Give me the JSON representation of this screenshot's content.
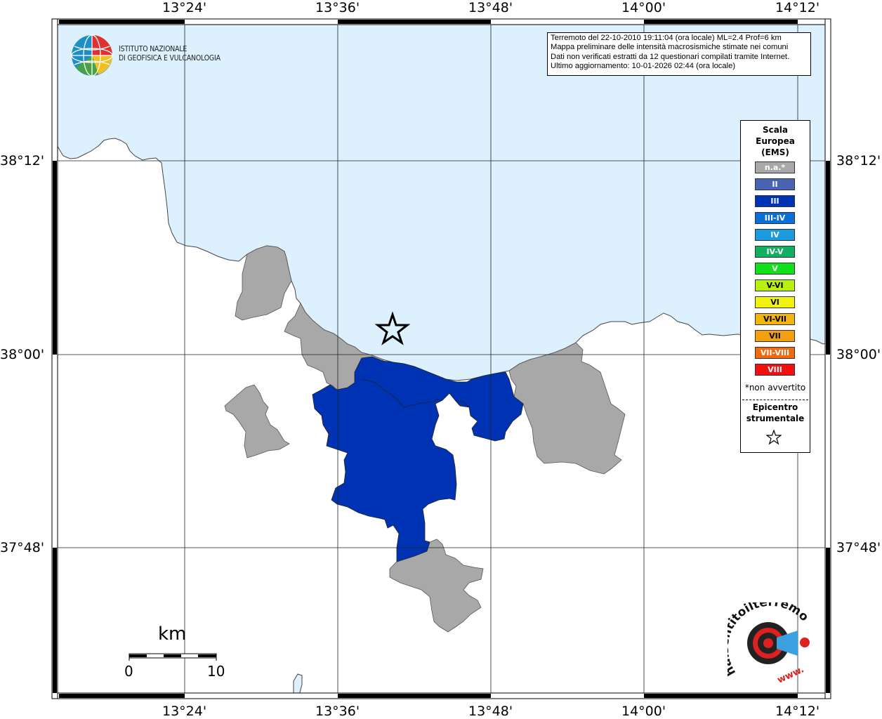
{
  "info": {
    "line1": "Terremoto del 22-10-2010 19:11:04 (ora locale) ML=2.4 Prof=6 km",
    "line2": "Mappa preliminare delle intensità macrosismiche stimate nei comuni",
    "line3": "Dati non verificati estratti da 12 questionari compilati tramite Internet.",
    "line4": "Ultimo aggiornamento: 10-01-2026 02:44 (ora locale)"
  },
  "logo": {
    "line1": "ISTITUTO NAZIONALE",
    "line2": "DI GEOFISICA E VULCANOLOGIA"
  },
  "axes": {
    "lon_labels": [
      "13°24'",
      "13°36'",
      "13°48'",
      "14°00'",
      "14°12'"
    ],
    "lat_labels": [
      "38°12'",
      "38°00'",
      "37°48'"
    ]
  },
  "legend": {
    "title1": "Scala",
    "title2": "Europea",
    "title3": "(EMS)",
    "items": [
      {
        "label": "n.a.*",
        "color": "#a8a8a8"
      },
      {
        "label": "II",
        "color": "#4a64b4"
      },
      {
        "label": "III",
        "color": "#0033b4"
      },
      {
        "label": "III-IV",
        "color": "#0b6fd8"
      },
      {
        "label": "IV",
        "color": "#1a9be0"
      },
      {
        "label": "IV-V",
        "color": "#0fb060"
      },
      {
        "label": "V",
        "color": "#11e01a"
      },
      {
        "label": "V-VI",
        "color": "#b8f00f"
      },
      {
        "label": "VI",
        "color": "#f2f20f"
      },
      {
        "label": "VI-VII",
        "color": "#f2b40f"
      },
      {
        "label": "VII",
        "color": "#f2a00f"
      },
      {
        "label": "VII-VIII",
        "color": "#f26a0f"
      },
      {
        "label": "VIII",
        "color": "#f20f0f"
      }
    ],
    "note": "*non avvertito",
    "epicenter_line1": "Epicentro",
    "epicenter_line2": "strumentale"
  },
  "scalebar": {
    "unit": "km",
    "min": "0",
    "max": "10"
  },
  "badge": {
    "text": "haisentitoilterremoto.it",
    "prefix": "www."
  },
  "colors": {
    "sea": "#ddf0fd",
    "land": "#ffffff",
    "na": "#a8a8a8",
    "intensity_III": "#0033b4"
  }
}
